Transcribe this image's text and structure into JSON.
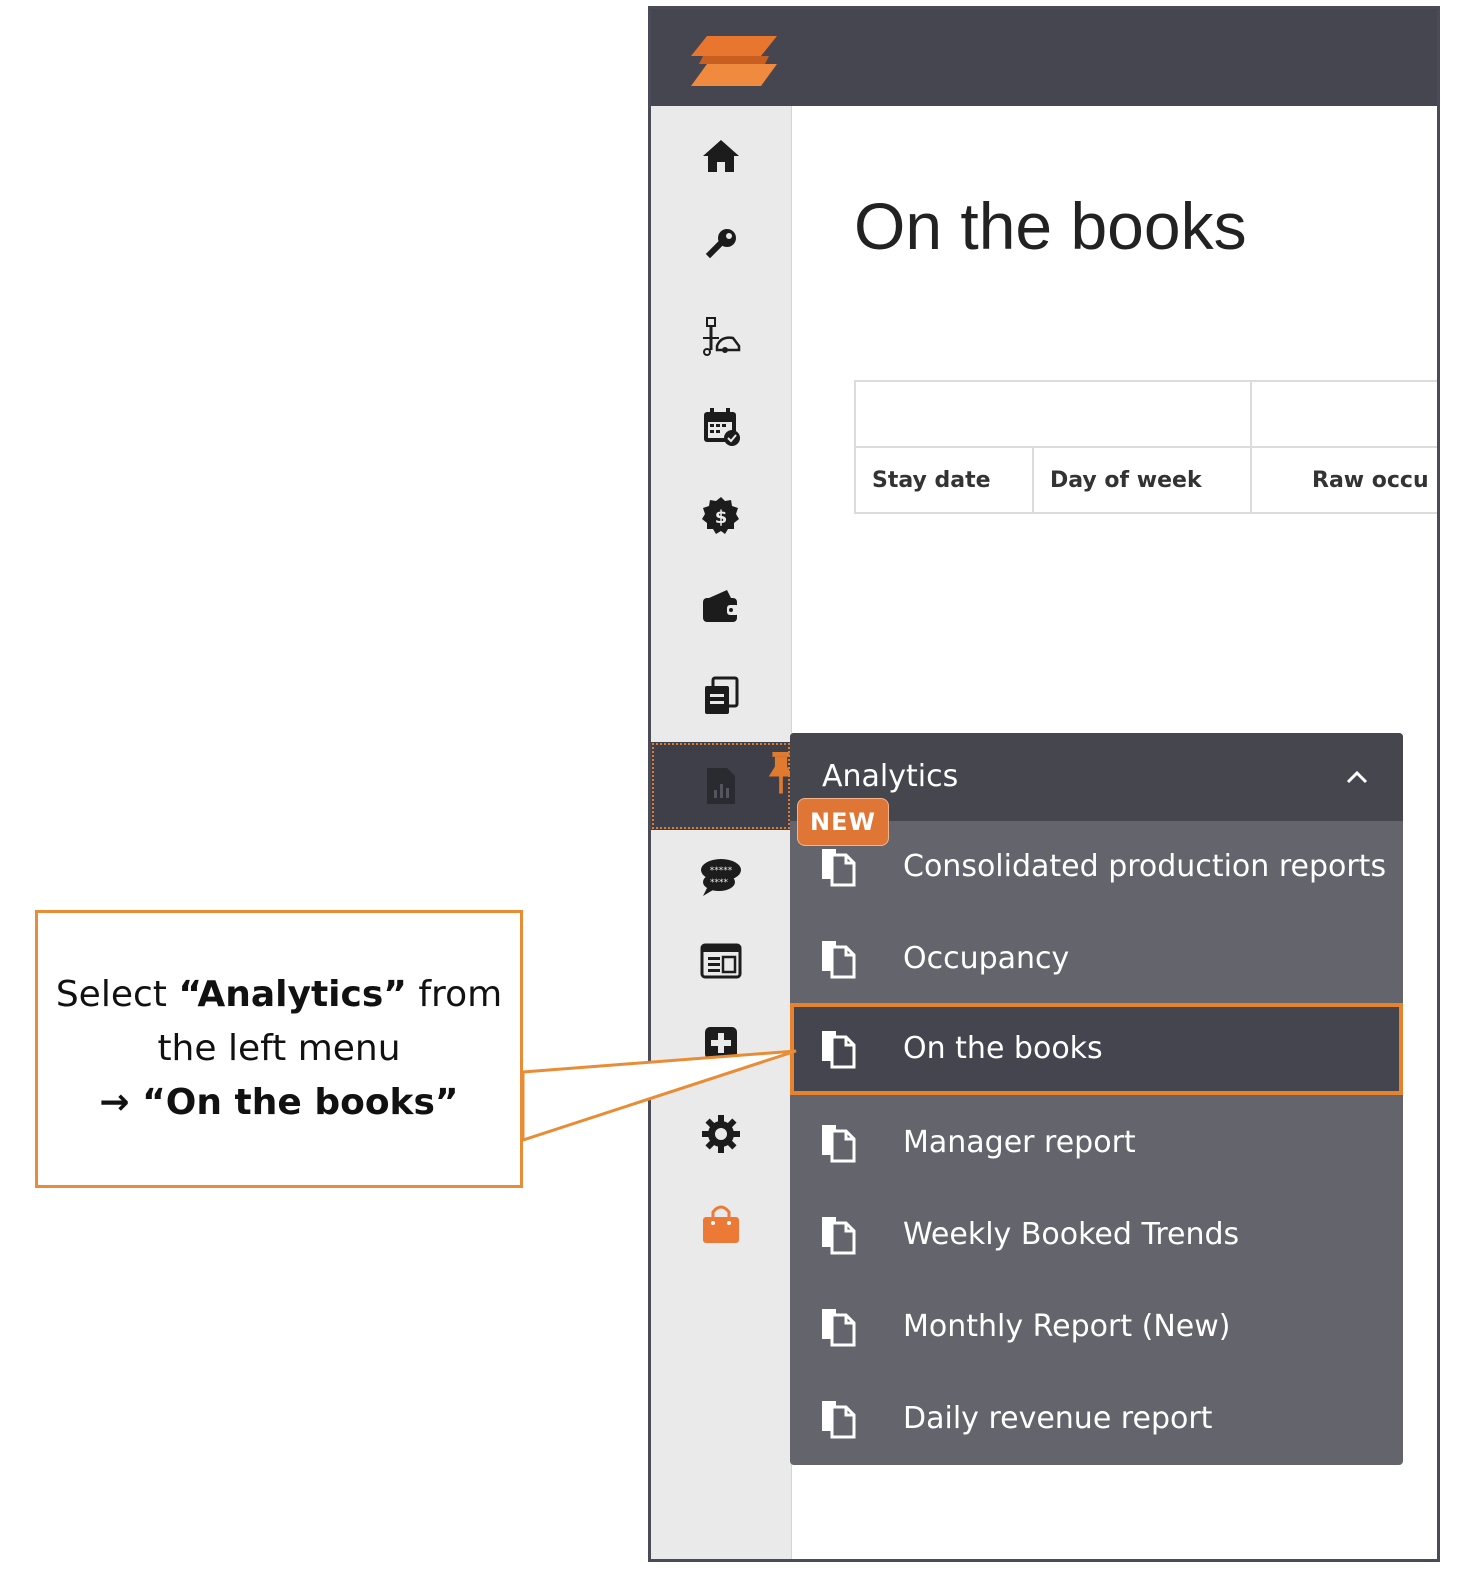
{
  "page": {
    "title": "On the books"
  },
  "colors": {
    "accent": "#e07a2e",
    "topbar": "#464651",
    "flyout": "#64646c",
    "sidebar": "#eaeaea"
  },
  "sidebar": {
    "items": [
      {
        "icon": "home-icon"
      },
      {
        "icon": "key-icon"
      },
      {
        "icon": "housekeeping-icon"
      },
      {
        "icon": "calendar-check-icon"
      },
      {
        "icon": "dollar-icon"
      },
      {
        "icon": "wallet-icon"
      },
      {
        "icon": "documents-icon"
      },
      {
        "icon": "analytics-icon",
        "active": true,
        "pinned": true
      },
      {
        "icon": "reviews-icon"
      },
      {
        "icon": "website-icon"
      },
      {
        "icon": "plus-square-icon"
      },
      {
        "icon": "gear-icon"
      },
      {
        "icon": "shopping-bag-icon"
      }
    ]
  },
  "table": {
    "columns": [
      "Stay date",
      "Day of week",
      "Raw occu"
    ]
  },
  "analytics_menu": {
    "title": "Analytics",
    "badge": "NEW",
    "items": [
      {
        "label": "Consolidated production reports"
      },
      {
        "label": "Occupancy"
      },
      {
        "label": "On the books",
        "active": true
      },
      {
        "label": "Manager report"
      },
      {
        "label": "Weekly Booked Trends"
      },
      {
        "label": "Monthly Report (New)"
      },
      {
        "label": "Daily revenue report"
      }
    ]
  },
  "callout": {
    "line1_pre": "Select ",
    "line1_bold": "“Analytics”",
    "line1_post": " from",
    "line2": "the left menu",
    "line3": "→ “On the books”"
  }
}
